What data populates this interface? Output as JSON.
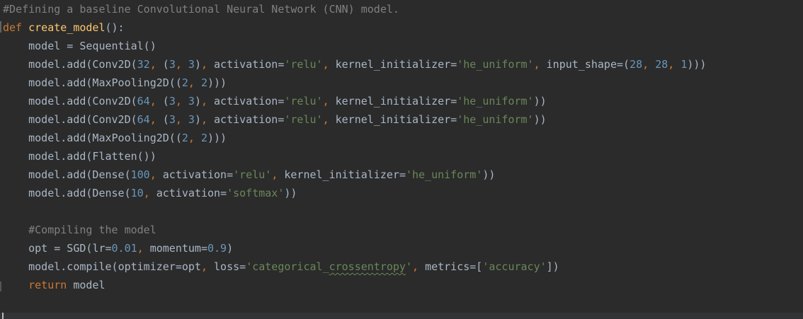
{
  "colors": {
    "background": "#2b2b2b",
    "default": "#a9b7c6",
    "comment": "#808080",
    "keyword": "#cc7832",
    "function": "#ffc66d",
    "number": "#6897bb",
    "string": "#6a8759",
    "parameter": "#aa4926"
  },
  "code": {
    "lines": [
      {
        "tokens": [
          {
            "t": "#Defining a baseline Convolutional Neural Network (CNN) model.",
            "c": "comment"
          }
        ]
      },
      {
        "tokens": [
          {
            "t": "def",
            "c": "keyword"
          },
          {
            "t": " ",
            "c": "default"
          },
          {
            "t": "create_model",
            "c": "function"
          },
          {
            "t": "():",
            "c": "default"
          }
        ]
      },
      {
        "tokens": [
          {
            "t": "    model = Sequential()",
            "c": "default"
          }
        ]
      },
      {
        "tokens": [
          {
            "t": "    model.add(Conv2D(",
            "c": "default"
          },
          {
            "t": "32",
            "c": "number"
          },
          {
            "t": ", ",
            "c": "punct"
          },
          {
            "t": "(",
            "c": "default"
          },
          {
            "t": "3",
            "c": "number"
          },
          {
            "t": ", ",
            "c": "punct"
          },
          {
            "t": "3",
            "c": "number"
          },
          {
            "t": ")",
            "c": "default"
          },
          {
            "t": ", ",
            "c": "punct"
          },
          {
            "t": "activation",
            "c": "parameter"
          },
          {
            "t": "=",
            "c": "default"
          },
          {
            "t": "'relu'",
            "c": "string"
          },
          {
            "t": ", ",
            "c": "punct"
          },
          {
            "t": "kernel_initializer",
            "c": "parameter"
          },
          {
            "t": "=",
            "c": "default"
          },
          {
            "t": "'he_uniform'",
            "c": "string"
          },
          {
            "t": ", ",
            "c": "punct"
          },
          {
            "t": "input_shape",
            "c": "parameter"
          },
          {
            "t": "=(",
            "c": "default"
          },
          {
            "t": "28",
            "c": "number"
          },
          {
            "t": ", ",
            "c": "punct"
          },
          {
            "t": "28",
            "c": "number"
          },
          {
            "t": ", ",
            "c": "punct"
          },
          {
            "t": "1",
            "c": "number"
          },
          {
            "t": ")))",
            "c": "default"
          }
        ]
      },
      {
        "tokens": [
          {
            "t": "    model.add(MaxPooling2D((",
            "c": "default"
          },
          {
            "t": "2",
            "c": "number"
          },
          {
            "t": ", ",
            "c": "punct"
          },
          {
            "t": "2",
            "c": "number"
          },
          {
            "t": ")))",
            "c": "default"
          }
        ]
      },
      {
        "tokens": [
          {
            "t": "    model.add(Conv2D(",
            "c": "default"
          },
          {
            "t": "64",
            "c": "number"
          },
          {
            "t": ", ",
            "c": "punct"
          },
          {
            "t": "(",
            "c": "default"
          },
          {
            "t": "3",
            "c": "number"
          },
          {
            "t": ", ",
            "c": "punct"
          },
          {
            "t": "3",
            "c": "number"
          },
          {
            "t": ")",
            "c": "default"
          },
          {
            "t": ", ",
            "c": "punct"
          },
          {
            "t": "activation",
            "c": "parameter"
          },
          {
            "t": "=",
            "c": "default"
          },
          {
            "t": "'relu'",
            "c": "string"
          },
          {
            "t": ", ",
            "c": "punct"
          },
          {
            "t": "kernel_initializer",
            "c": "parameter"
          },
          {
            "t": "=",
            "c": "default"
          },
          {
            "t": "'he_uniform'",
            "c": "string"
          },
          {
            "t": "))",
            "c": "default"
          }
        ]
      },
      {
        "tokens": [
          {
            "t": "    model.add(Conv2D(",
            "c": "default"
          },
          {
            "t": "64",
            "c": "number"
          },
          {
            "t": ", ",
            "c": "punct"
          },
          {
            "t": "(",
            "c": "default"
          },
          {
            "t": "3",
            "c": "number"
          },
          {
            "t": ", ",
            "c": "punct"
          },
          {
            "t": "3",
            "c": "number"
          },
          {
            "t": ")",
            "c": "default"
          },
          {
            "t": ", ",
            "c": "punct"
          },
          {
            "t": "activation",
            "c": "parameter"
          },
          {
            "t": "=",
            "c": "default"
          },
          {
            "t": "'relu'",
            "c": "string"
          },
          {
            "t": ", ",
            "c": "punct"
          },
          {
            "t": "kernel_initializer",
            "c": "parameter"
          },
          {
            "t": "=",
            "c": "default"
          },
          {
            "t": "'he_uniform'",
            "c": "string"
          },
          {
            "t": "))",
            "c": "default"
          }
        ]
      },
      {
        "tokens": [
          {
            "t": "    model.add(MaxPooling2D((",
            "c": "default"
          },
          {
            "t": "2",
            "c": "number"
          },
          {
            "t": ", ",
            "c": "punct"
          },
          {
            "t": "2",
            "c": "number"
          },
          {
            "t": ")))",
            "c": "default"
          }
        ]
      },
      {
        "tokens": [
          {
            "t": "    model.add(Flatten())",
            "c": "default"
          }
        ]
      },
      {
        "tokens": [
          {
            "t": "    model.add(Dense(",
            "c": "default"
          },
          {
            "t": "100",
            "c": "number"
          },
          {
            "t": ", ",
            "c": "punct"
          },
          {
            "t": "activation",
            "c": "parameter"
          },
          {
            "t": "=",
            "c": "default"
          },
          {
            "t": "'relu'",
            "c": "string"
          },
          {
            "t": ", ",
            "c": "punct"
          },
          {
            "t": "kernel_initializer",
            "c": "parameter"
          },
          {
            "t": "=",
            "c": "default"
          },
          {
            "t": "'he_uniform'",
            "c": "string"
          },
          {
            "t": "))",
            "c": "default"
          }
        ]
      },
      {
        "tokens": [
          {
            "t": "    model.add(Dense(",
            "c": "default"
          },
          {
            "t": "10",
            "c": "number"
          },
          {
            "t": ", ",
            "c": "punct"
          },
          {
            "t": "activation",
            "c": "parameter"
          },
          {
            "t": "=",
            "c": "default"
          },
          {
            "t": "'softmax'",
            "c": "string"
          },
          {
            "t": "))",
            "c": "default"
          }
        ]
      },
      {
        "tokens": []
      },
      {
        "tokens": [
          {
            "t": "    #Compiling the model",
            "c": "comment"
          }
        ]
      },
      {
        "tokens": [
          {
            "t": "    opt = SGD(",
            "c": "default"
          },
          {
            "t": "lr",
            "c": "parameter"
          },
          {
            "t": "=",
            "c": "default"
          },
          {
            "t": "0.01",
            "c": "number"
          },
          {
            "t": ", ",
            "c": "punct"
          },
          {
            "t": "momentum",
            "c": "parameter"
          },
          {
            "t": "=",
            "c": "default"
          },
          {
            "t": "0.9",
            "c": "number"
          },
          {
            "t": ")",
            "c": "default"
          }
        ]
      },
      {
        "tokens": [
          {
            "t": "    model.compile(",
            "c": "default"
          },
          {
            "t": "optimizer",
            "c": "parameter"
          },
          {
            "t": "=opt",
            "c": "default"
          },
          {
            "t": ", ",
            "c": "punct"
          },
          {
            "t": "loss",
            "c": "parameter"
          },
          {
            "t": "=",
            "c": "default"
          },
          {
            "t": "'categorical_",
            "c": "string"
          },
          {
            "t": "crossentropy",
            "c": "string",
            "squiggle": true
          },
          {
            "t": "'",
            "c": "string"
          },
          {
            "t": ", ",
            "c": "punct"
          },
          {
            "t": "metrics",
            "c": "parameter"
          },
          {
            "t": "=[",
            "c": "default"
          },
          {
            "t": "'accuracy'",
            "c": "string"
          },
          {
            "t": "])",
            "c": "default"
          }
        ]
      },
      {
        "tokens": [
          {
            "t": "    ",
            "c": "default"
          },
          {
            "t": "return",
            "c": "keyword"
          },
          {
            "t": " model",
            "c": "default"
          }
        ]
      }
    ]
  }
}
